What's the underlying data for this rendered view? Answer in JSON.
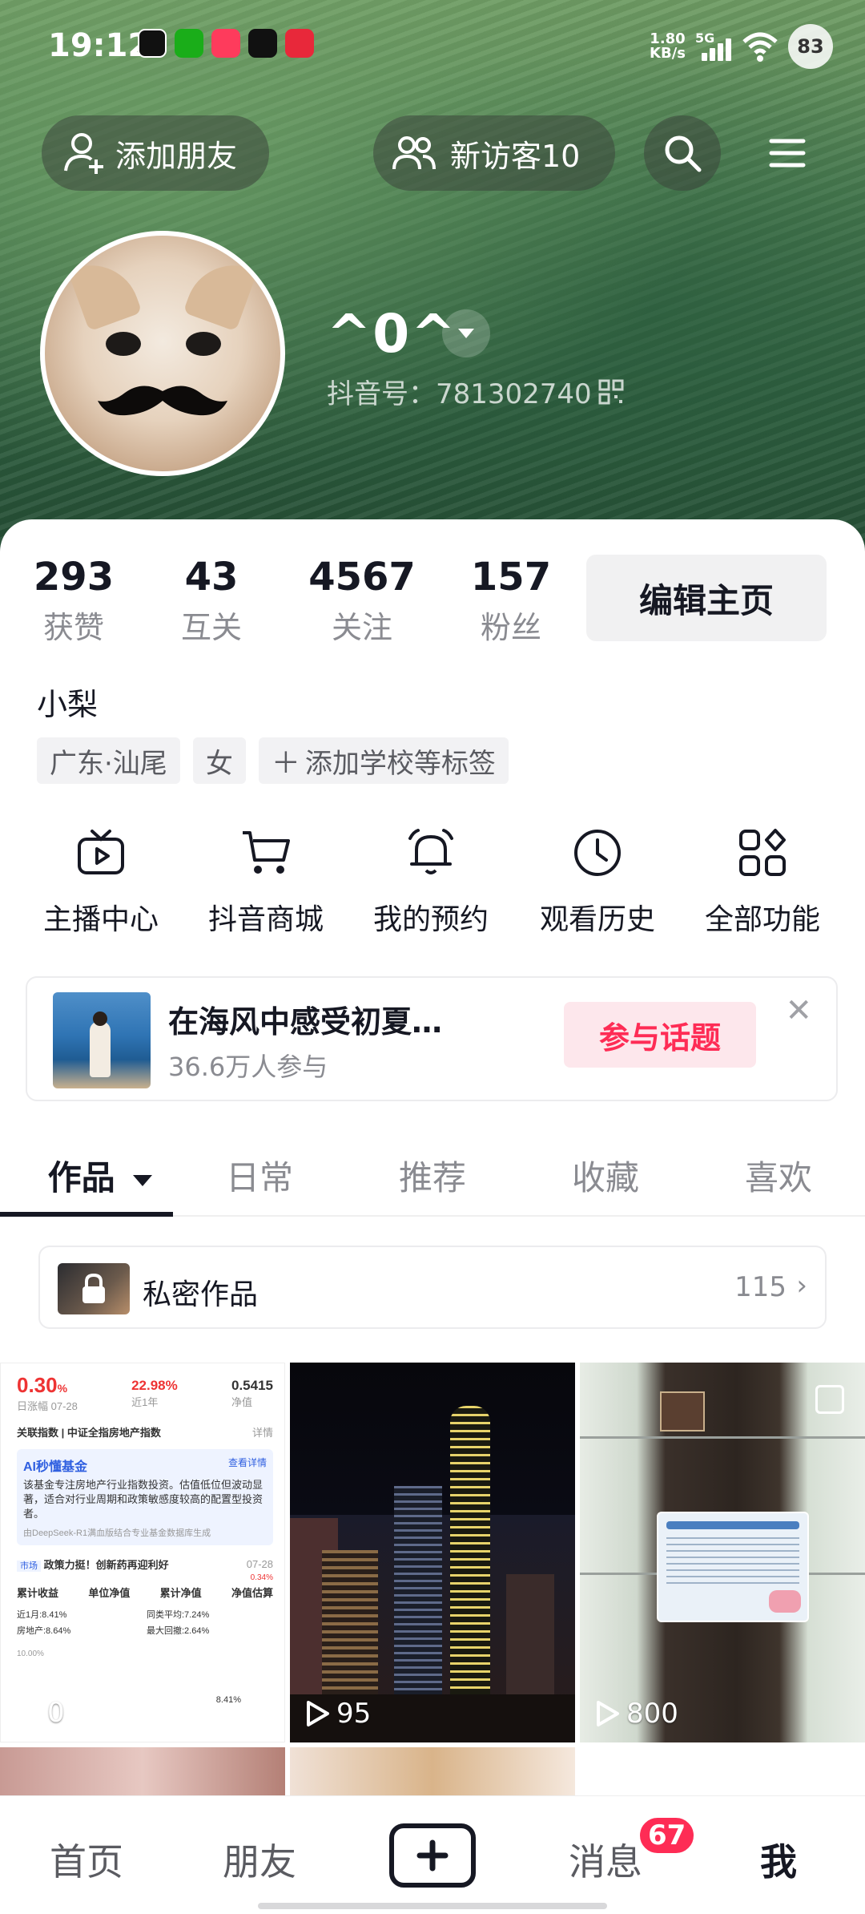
{
  "status": {
    "time": "19:12",
    "net_speed_value": "1.80",
    "net_speed_unit": "KB/s",
    "network": "5G",
    "battery": "83",
    "apps": [
      "tiktok-icon",
      "wechat-icon",
      "music-icon",
      "tiktok-icon",
      "lychee-icon"
    ]
  },
  "header": {
    "add_friend": "添加朋友",
    "visitors": "新访客10",
    "username": "^0^",
    "douyin_id": "抖音号：781302740"
  },
  "stats": [
    {
      "value": "293",
      "label": "获赞"
    },
    {
      "value": "43",
      "label": "互关"
    },
    {
      "value": "4567",
      "label": "关注"
    },
    {
      "value": "157",
      "label": "粉丝"
    }
  ],
  "edit_profile": "编辑主页",
  "nickname": "小梨",
  "tags": {
    "location": "广东·汕尾",
    "gender": "女",
    "add": "添加学校等标签"
  },
  "features": [
    {
      "label": "主播中心",
      "icon": "tv-icon"
    },
    {
      "label": "抖音商城",
      "icon": "cart-icon"
    },
    {
      "label": "我的预约",
      "icon": "bell-icon"
    },
    {
      "label": "观看历史",
      "icon": "clock-icon"
    },
    {
      "label": "全部功能",
      "icon": "grid-icon"
    }
  ],
  "topic": {
    "title": "在海风中感受初夏…",
    "participants": "36.6万人参与",
    "button": "参与话题"
  },
  "tabs": [
    "作品",
    "日常",
    "推荐",
    "收藏",
    "喜欢"
  ],
  "private_works": {
    "label": "私密作品",
    "count": "115"
  },
  "videos": [
    {
      "plays": "0"
    },
    {
      "plays": "95"
    },
    {
      "plays": "800"
    }
  ],
  "fund_card": {
    "pct1": "0.30",
    "pct1_unit": "%",
    "pct1_label": "日涨幅 07-28",
    "pct2": "22.98%",
    "pct2_label": "近1年",
    "nav": "0.5415",
    "nav_label": "净值",
    "index_line": "关联指数 | 中证全指房地产指数",
    "details": "详情",
    "ai_title": "AI秒懂基金",
    "ai_more": "查看详情",
    "ai_text": "该基金专注房地产行业指数投资。估值低位但波动显著，适合对行业周期和政策敏感度较高的配置型投资者。",
    "ai_source": "由DeepSeek-R1满血版结合专业基金数据库生成",
    "news_tag": "市场",
    "news": "政策力挺！创新药再迎利好",
    "news_date": "07-28",
    "tabs": [
      "累计收益",
      "单位净值",
      "累计净值",
      "净值估算"
    ],
    "est": "0.34%",
    "rows": [
      "近1月:8.41%",
      "同类平均:7.24%",
      "房地产:8.64%",
      "最大回撤:2.64%"
    ],
    "chart_start": "10.00%",
    "chart_end": "8.41%"
  },
  "bottom_nav": {
    "home": "首页",
    "friends": "朋友",
    "messages": "消息",
    "messages_badge": "67",
    "me": "我"
  }
}
